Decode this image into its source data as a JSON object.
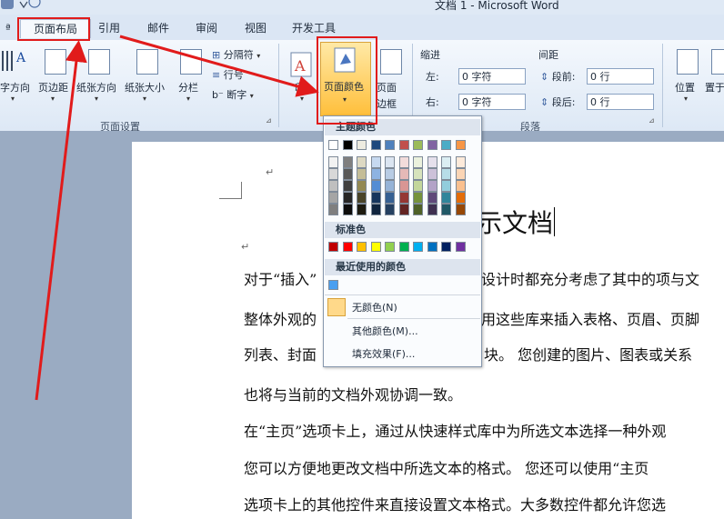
{
  "window": {
    "title": "文档 1 - Microsoft Word"
  },
  "tabs": [
    "页面布局",
    "引用",
    "邮件",
    "审阅",
    "视图",
    "开发工具"
  ],
  "ribbon": {
    "page_setup": {
      "buttons": [
        "字方向",
        "页边距",
        "纸张方向",
        "纸张大小",
        "分栏"
      ],
      "small": [
        "分隔符",
        "行号",
        "断字"
      ],
      "label": "页面设置"
    },
    "background": {
      "buttons": [
        "页面颜色",
        "页面边框"
      ],
      "page_border_lines": [
        "页面",
        "边框"
      ]
    },
    "paragraph": {
      "indent_label": "缩进",
      "spacing_label": "间距",
      "left_label": "左:",
      "right_label": "右:",
      "left_value": "0 字符",
      "right_value": "0 字符",
      "before_label": "段前:",
      "after_label": "段后:",
      "before_value": "0 行",
      "after_value": "0 行",
      "label": "段落"
    },
    "arrange": {
      "buttons": [
        "位置",
        "置于"
      ]
    }
  },
  "dropdown": {
    "theme_colors_header": "主题颜色",
    "standard_colors_header": "标准色",
    "recent_colors_header": "最近使用的颜色",
    "no_color": "无颜色(N)",
    "more_colors": "其他颜色(M)...",
    "fill_effects": "填充效果(F)...",
    "theme_top": [
      "#ffffff",
      "#000000",
      "#eeece1",
      "#1f497d",
      "#4f81bd",
      "#c0504d",
      "#9bbb59",
      "#8064a2",
      "#4bacc6",
      "#f79646"
    ],
    "theme_shades": [
      [
        "#f2f2f2",
        "#7f7f7f",
        "#ddd9c3",
        "#c6d9f0",
        "#dbe5f1",
        "#f2dcdb",
        "#ebf1dd",
        "#e5e0ec",
        "#dbeef3",
        "#fdeada"
      ],
      [
        "#d8d8d8",
        "#595959",
        "#c4bd97",
        "#8db3e2",
        "#b8cce4",
        "#e5b9b7",
        "#d7e3bc",
        "#ccc1d9",
        "#b7dde8",
        "#fbd5b5"
      ],
      [
        "#bfbfbf",
        "#3f3f3f",
        "#938953",
        "#548dd4",
        "#95b3d7",
        "#d99694",
        "#c3d69b",
        "#b2a2c7",
        "#92cddc",
        "#fac08f"
      ],
      [
        "#a5a5a5",
        "#262626",
        "#494429",
        "#17365d",
        "#366092",
        "#953734",
        "#76923c",
        "#5f497a",
        "#31859b",
        "#e36c09"
      ],
      [
        "#7f7f7f",
        "#0c0c0c",
        "#1d1b10",
        "#0f243e",
        "#244061",
        "#632423",
        "#4f6128",
        "#3f3151",
        "#205867",
        "#974806"
      ]
    ],
    "standard": [
      "#c00000",
      "#ff0000",
      "#ffc000",
      "#ffff00",
      "#92d050",
      "#00b050",
      "#00b0f0",
      "#0070c0",
      "#002060",
      "#7030a0"
    ],
    "recent": [
      "#4a9ff0"
    ]
  },
  "document": {
    "title_visible": "示文档",
    "lines": [
      "对于“插入”",
      "整体外观的",
      "列表、封面",
      "也将与当前的文档外观协调一致。",
      "在“主页”选项卡上，通过从快速样式库中为所选文本选择一种外观",
      "您可以方便地更改文档中所选文本的格式。 您还可以使用“主页",
      "选项卡上的其他控件来直接设置文本格式。大多数控件都允许您选"
    ],
    "line1_right": "设计时都充分考虑了其中的项与文",
    "line2_right": "用这些库来插入表格、页眉、页脚",
    "line3_right": "块。 您创建的图片、图表或关系"
  }
}
